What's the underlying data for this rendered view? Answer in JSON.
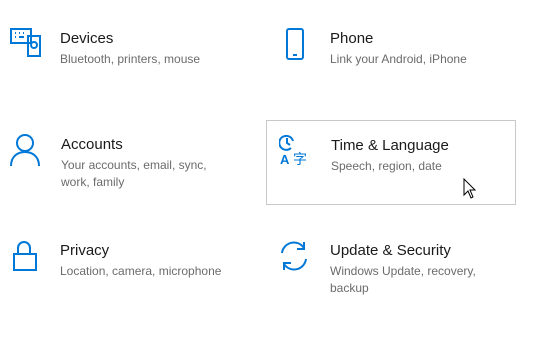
{
  "colors": {
    "accent": "#0078d7",
    "title": "#1a1a1a",
    "desc": "#6b6b6b",
    "hover_border": "#c8c8c8"
  },
  "tiles": [
    {
      "id": "devices",
      "title": "Devices",
      "desc": "Bluetooth, printers, mouse",
      "icon": "devices-icon"
    },
    {
      "id": "phone",
      "title": "Phone",
      "desc": "Link your Android, iPhone",
      "icon": "phone-icon"
    },
    {
      "id": "accounts",
      "title": "Accounts",
      "desc": "Your accounts, email, sync, work, family",
      "icon": "person-icon"
    },
    {
      "id": "time",
      "title": "Time & Language",
      "desc": "Speech, region, date",
      "icon": "time-language-icon"
    },
    {
      "id": "privacy",
      "title": "Privacy",
      "desc": "Location, camera, microphone",
      "icon": "lock-icon"
    },
    {
      "id": "update",
      "title": "Update & Security",
      "desc": "Windows Update, recovery, backup",
      "icon": "sync-icon"
    }
  ]
}
